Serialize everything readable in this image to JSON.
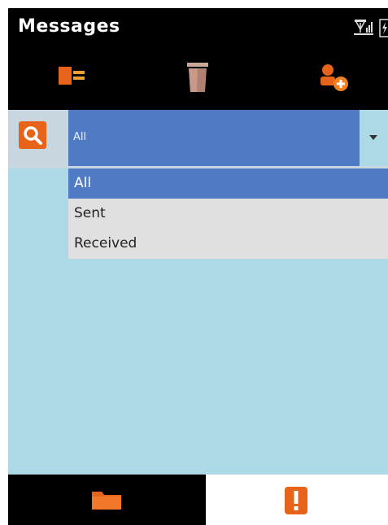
{
  "window": {
    "title": "Messages"
  },
  "status": {
    "icons": [
      "signal-icon",
      "battery-icon"
    ]
  },
  "toolbar": {
    "buttons": [
      {
        "icon": "move-to-folder-icon"
      },
      {
        "icon": "trash-icon"
      },
      {
        "icon": "add-contact-icon"
      }
    ]
  },
  "filter": {
    "search_icon": "search-icon",
    "selected": "All",
    "options": [
      "All",
      "Sent",
      "Received"
    ]
  },
  "bottom_tabs": [
    {
      "icon": "folder-icon",
      "active": false
    },
    {
      "icon": "alert-icon",
      "active": true
    }
  ],
  "colors": {
    "accent": "#e8631a",
    "selection": "#4f7bc4",
    "background": "#add8e6",
    "bar": "#000000"
  }
}
